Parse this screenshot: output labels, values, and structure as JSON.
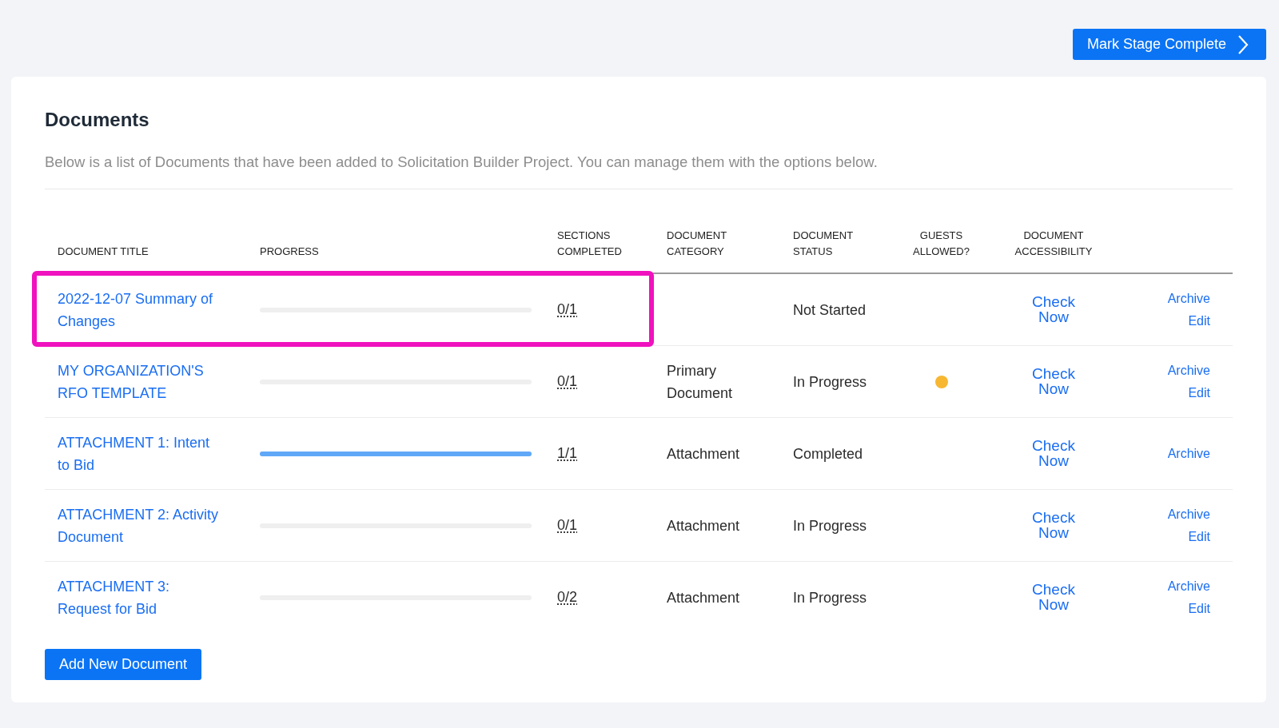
{
  "header_button": {
    "label": "Mark Stage Complete"
  },
  "panel": {
    "title": "Documents",
    "description": "Below is a list of Documents that have been added to Solicitation Builder Project. You can manage them with the options below."
  },
  "table": {
    "columns": [
      "DOCUMENT TITLE",
      "PROGRESS",
      "SECTIONS COMPLETED",
      "DOCUMENT CATEGORY",
      "DOCUMENT STATUS",
      "GUESTS ALLOWED?",
      "DOCUMENT ACCESSIBILITY"
    ],
    "rows": [
      {
        "title": "2022-12-07 Summary of Changes",
        "level": 0,
        "sections": "0/1",
        "category": "",
        "status": "Not Started",
        "guests_allowed": false,
        "accessibility": "Check Now",
        "actions": [
          "Archive",
          "Edit"
        ],
        "highlighted": true
      },
      {
        "title": "MY ORGANIZATION'S RFO TEMPLATE",
        "level": 0,
        "sections": "0/1",
        "category": "Primary Document",
        "status": "In Progress",
        "guests_allowed": true,
        "accessibility": "Check Now",
        "actions": [
          "Archive",
          "Edit"
        ],
        "highlighted": false
      },
      {
        "title": "ATTACHMENT 1: Intent to Bid",
        "level": 1,
        "sections": "1/1",
        "category": "Attachment",
        "status": "Completed",
        "guests_allowed": false,
        "accessibility": "Check Now",
        "actions": [
          "Archive"
        ],
        "highlighted": false
      },
      {
        "title": "ATTACHMENT 2: Activity Document",
        "level": 0,
        "sections": "0/1",
        "category": "Attachment",
        "status": "In Progress",
        "guests_allowed": false,
        "accessibility": "Check Now",
        "actions": [
          "Archive",
          "Edit"
        ],
        "highlighted": false
      },
      {
        "title": "ATTACHMENT 3: Request for Bid",
        "level": 0,
        "sections": "0/2",
        "category": "Attachment",
        "status": "In Progress",
        "guests_allowed": false,
        "accessibility": "Check Now",
        "actions": [
          "Archive",
          "Edit"
        ],
        "highlighted": false
      }
    ]
  },
  "add_button": {
    "label": "Add New Document"
  }
}
